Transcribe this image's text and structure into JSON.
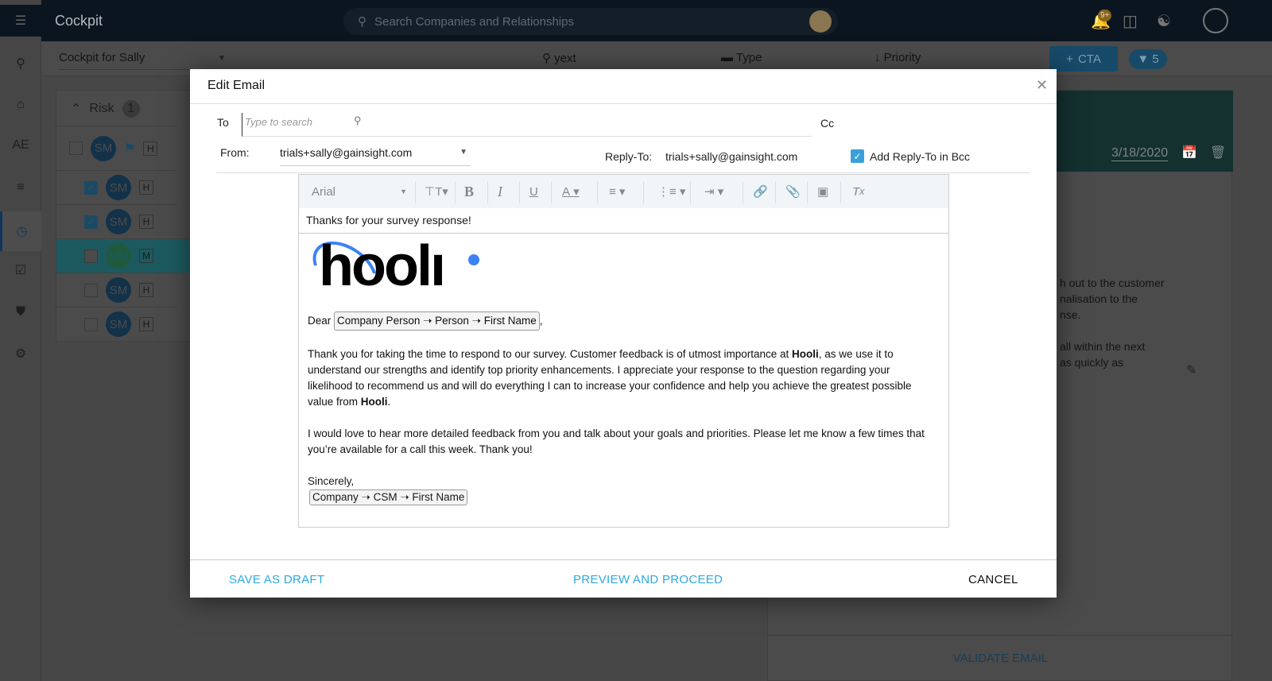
{
  "app": {
    "title": "Cockpit",
    "search_placeholder": "Search Companies and Relationships",
    "notification_badge": "9+"
  },
  "rail": {
    "items": [
      "search",
      "home",
      "AE",
      "timeline",
      "cockpit",
      "tasks",
      "hierarchy",
      "settings"
    ],
    "ae_label": "AE"
  },
  "subbar": {
    "cockpit_select": "Cockpit for Sally",
    "search_value": "yext",
    "type_label": "Type",
    "priority_label": "Priority",
    "cta_label": "CTA",
    "filter_count": "5"
  },
  "list": {
    "group_label": "Risk",
    "group_count": "1",
    "header_initials": "SM",
    "header_priority": "H",
    "rows": [
      {
        "initials": "SM",
        "priority": "H",
        "checked": true
      },
      {
        "initials": "SM",
        "priority": "H",
        "checked": true
      },
      {
        "initials": "MM",
        "priority": "M",
        "checked": false
      },
      {
        "initials": "SM",
        "priority": "H",
        "checked": false
      },
      {
        "initials": "SM",
        "priority": "H",
        "checked": false
      }
    ]
  },
  "detail": {
    "date": "3/18/2020",
    "text_fragments": [
      "h out to the customer",
      "nalisation to the",
      "nse.",
      "all within the next",
      "as quickly as"
    ],
    "validate_label": "VALIDATE EMAIL"
  },
  "modal": {
    "title": "Edit Email",
    "to_label": "To",
    "to_placeholder": "Type to search",
    "cc_label": "Cc",
    "from_label": "From:",
    "from_value": "trials+sally@gainsight.com",
    "reply_to_label": "Reply-To:",
    "reply_to_value": "trials+sally@gainsight.com",
    "bcc_label": "Add Reply-To in Bcc",
    "bcc_checked": true,
    "toolbar": {
      "font": "Arial"
    },
    "subject": "Thanks for your survey response!",
    "logo_text": "hooli",
    "body": {
      "dear": "Dear",
      "token_first_name": "Company Person ➝ Person ➝ First Name",
      "p1a": "Thank you for taking the time to respond to our survey. Customer feedback is of utmost importance at ",
      "brand": "Hooli",
      "p1b": ", as we use it to understand our strengths and identify top priority enhancements. I appreciate your response to the question regarding your likelihood to recommend us and will do everything I can to increase your confidence and help you achieve the greatest possible value from ",
      "p2": "I would love to hear more detailed feedback from you and talk about your goals and priorities. Please let me know a few times that you’re available for a call this week. Thank you!",
      "sincerely": "Sincerely,",
      "token_csm": "Company ➝ CSM ➝ First Name"
    },
    "footer": {
      "save_draft": "SAVE AS DRAFT",
      "preview": "PREVIEW AND PROCEED",
      "cancel": "CANCEL"
    }
  },
  "colors": {
    "accent": "#2ea8e0",
    "nav": "#22364d",
    "teal": "#1f6f7a"
  }
}
